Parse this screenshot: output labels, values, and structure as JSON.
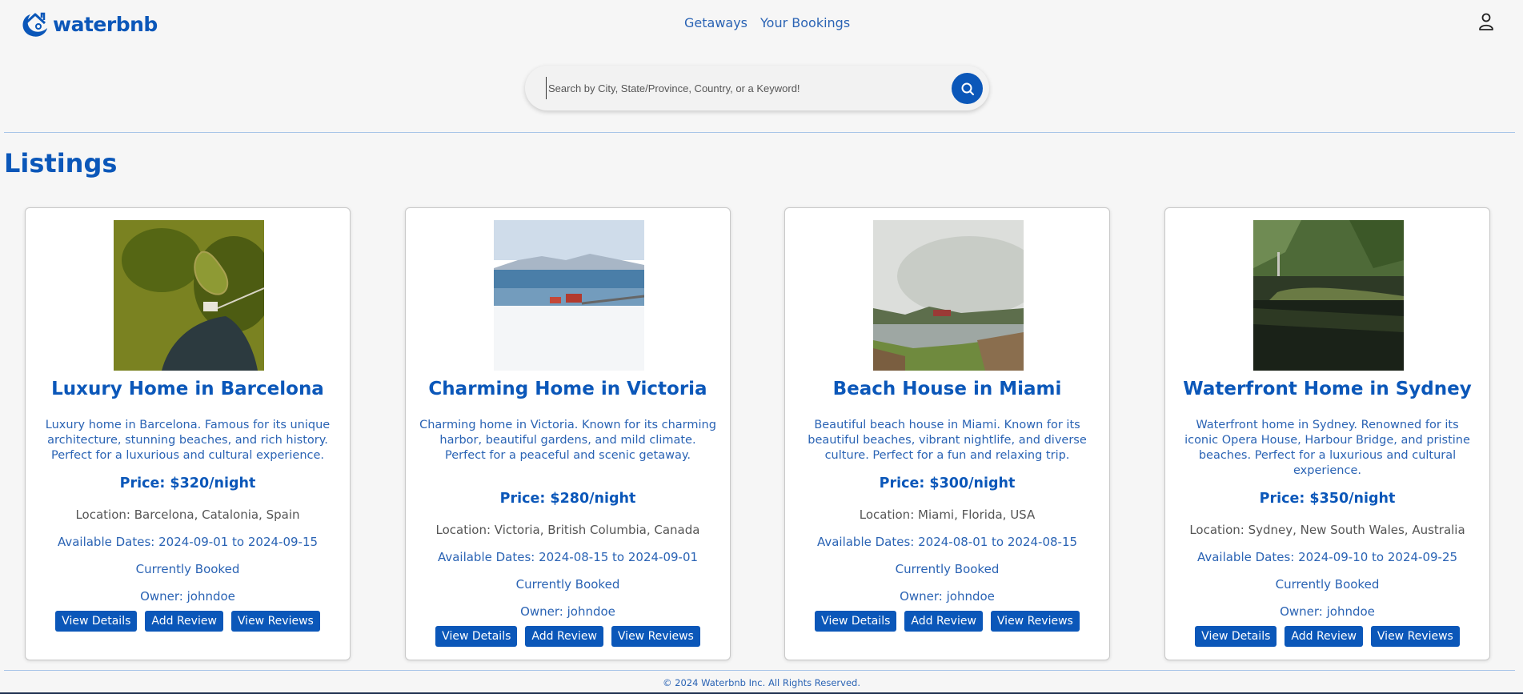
{
  "header": {
    "brand": "waterbnb",
    "nav": [
      "Getaways",
      "Your Bookings"
    ]
  },
  "search": {
    "placeholder": "Search by City, State/Province, Country, or a Keyword!"
  },
  "page_title": "Listings",
  "listings": [
    {
      "title": "Luxury Home in Barcelona",
      "description": "Luxury home in Barcelona. Famous for its unique architecture, stunning beaches, and rich history. Perfect for a luxurious and cultural experience.",
      "price": "Price: $320/night",
      "location": "Location: Barcelona, Catalonia, Spain",
      "dates": "Available Dates: 2024-09-01 to 2024-09-15",
      "status": "Currently Booked",
      "owner": "Owner: johndoe"
    },
    {
      "title": "Charming Home in Victoria",
      "description": "Charming home in Victoria. Known for its charming harbor, beautiful gardens, and mild climate. Perfect for a peaceful and scenic getaway.",
      "price": "Price: $280/night",
      "location": "Location: Victoria, British Columbia, Canada",
      "dates": "Available Dates: 2024-08-15 to 2024-09-01",
      "status": "Currently Booked",
      "owner": "Owner: johndoe"
    },
    {
      "title": "Beach House in Miami",
      "description": "Beautiful beach house in Miami. Known for its beautiful beaches, vibrant nightlife, and diverse culture. Perfect for a fun and relaxing trip.",
      "price": "Price: $300/night",
      "location": "Location: Miami, Florida, USA",
      "dates": "Available Dates: 2024-08-01 to 2024-08-15",
      "status": "Currently Booked",
      "owner": "Owner: johndoe"
    },
    {
      "title": "Waterfront Home in Sydney",
      "description": "Waterfront home in Sydney. Renowned for its iconic Opera House, Harbour Bridge, and pristine beaches. Perfect for a luxurious and cultural experience.",
      "price": "Price: $350/night",
      "location": "Location: Sydney, New South Wales, Australia",
      "dates": "Available Dates: 2024-09-10 to 2024-09-25",
      "status": "Currently Booked",
      "owner": "Owner: johndoe"
    }
  ],
  "buttons": {
    "details": "View Details",
    "add_review": "Add Review",
    "view_reviews": "View Reviews"
  },
  "footer": "© 2024 Waterbnb Inc. All Rights Reserved.",
  "colors": {
    "brand": "#0b57b9",
    "background": "#f6f6f6"
  }
}
